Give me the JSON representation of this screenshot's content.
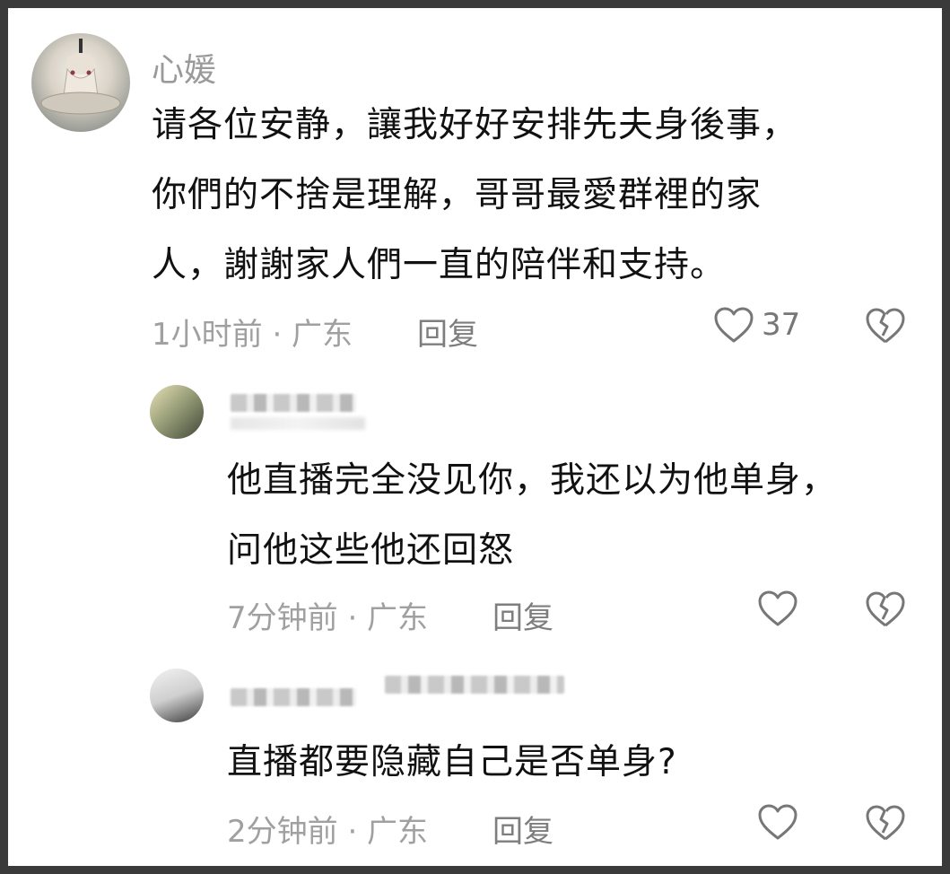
{
  "main_comment": {
    "username": "心媛",
    "lines": [
      "请各位安静，讓我好好安排先夫身後事，",
      "你們的不捨是理解，哥哥最愛群裡的家",
      "人，謝謝家人們一直的陪伴和支持。"
    ],
    "time_location": "1小时前 · 广东",
    "reply_label": "回复",
    "like_count": "37"
  },
  "reply1": {
    "lines": [
      "他直播完全没见你，我还以为他单身，",
      "问他这些他还回怒"
    ],
    "time_location": "7分钟前 · 广东",
    "reply_label": "回复"
  },
  "reply2": {
    "lines": [
      "直播都要隐藏自己是否单身?"
    ],
    "time_location": "2分钟前 · 广东",
    "reply_label": "回复"
  },
  "icons": {
    "like": "heart-outline-icon",
    "dislike": "broken-heart-icon"
  },
  "colors": {
    "text": "#111111",
    "meta": "#a0a0a0",
    "icon": "#777777"
  }
}
